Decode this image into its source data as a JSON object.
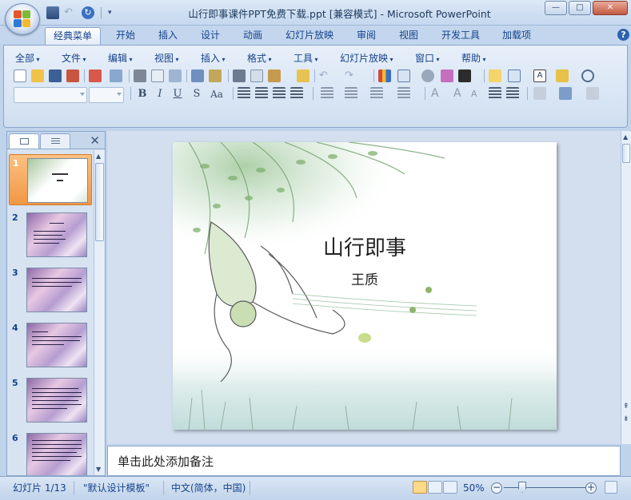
{
  "window": {
    "title": "山行即事课件PPT免费下载.ppt [兼容模式] - Microsoft PowerPoint",
    "minimize": "—",
    "maximize": "□",
    "close": "✕"
  },
  "ribbon_tabs": [
    "经典菜单",
    "开始",
    "插入",
    "设计",
    "动画",
    "幻灯片放映",
    "审阅",
    "视图",
    "开发工具",
    "加载项"
  ],
  "help_label": "?",
  "classic_menu": [
    "全部",
    "文件",
    "编辑",
    "视图",
    "插入",
    "格式",
    "工具",
    "幻灯片放映",
    "窗口",
    "帮助"
  ],
  "format_buttons": [
    "B",
    "I",
    "U",
    "S",
    "Aa"
  ],
  "thumbnails": {
    "close": "✕",
    "items": [
      {
        "num": "1",
        "selected": true
      },
      {
        "num": "2",
        "selected": false
      },
      {
        "num": "3",
        "selected": false
      },
      {
        "num": "4",
        "selected": false
      },
      {
        "num": "5",
        "selected": false
      },
      {
        "num": "6",
        "selected": false
      }
    ]
  },
  "slide": {
    "title": "山行即事",
    "subtitle": "王质"
  },
  "notes": {
    "placeholder": "单击此处添加备注"
  },
  "status": {
    "slide_info": "幻灯片 1/13",
    "theme": "\"默认设计模板\"",
    "language": "中文(简体，中国)",
    "zoom": "50%",
    "zoom_out": "−",
    "zoom_in": "+"
  },
  "colors": {
    "selected_thumb": "#f19745",
    "ribbon_bg": "#d9e6f5",
    "title_text": "#1e395b"
  }
}
